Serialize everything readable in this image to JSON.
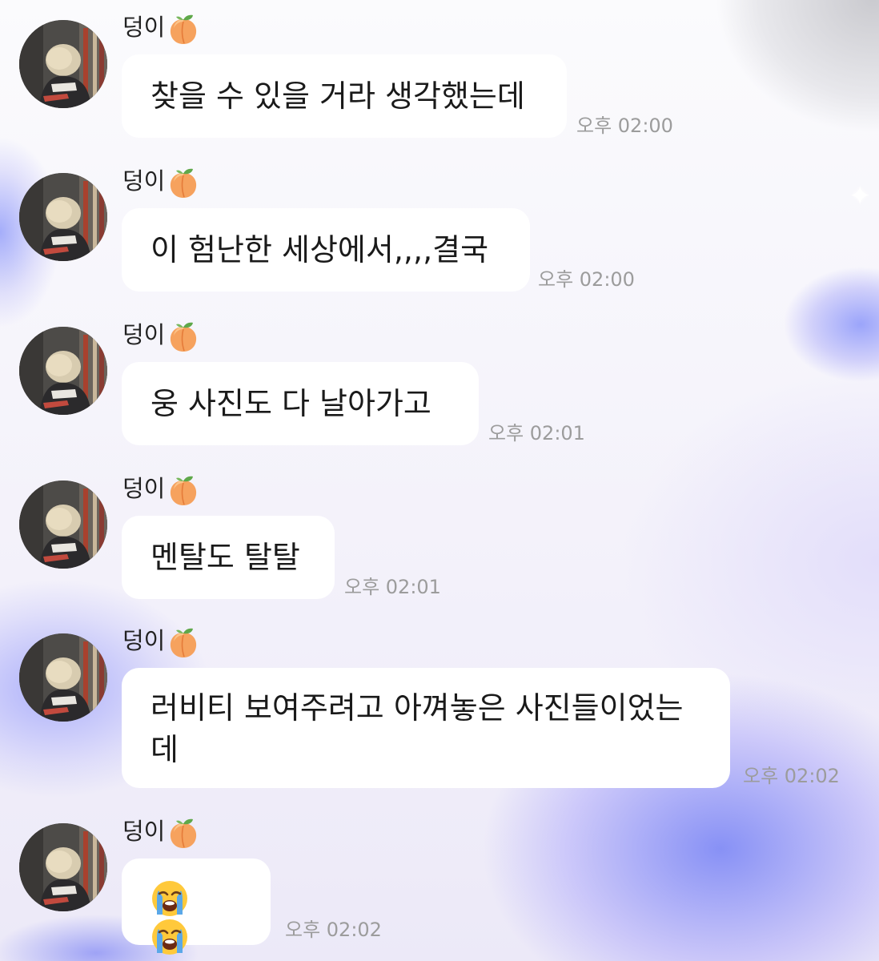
{
  "chat": {
    "messages": [
      {
        "sender": "덩이",
        "sender_emoji": "peach-icon",
        "text": "찾을 수 있을 거라 생각했는데",
        "time": "오후 02:00"
      },
      {
        "sender": "덩이",
        "sender_emoji": "peach-icon",
        "text": "이 험난한 세상에서,,,,결국",
        "time": "오후 02:00"
      },
      {
        "sender": "덩이",
        "sender_emoji": "peach-icon",
        "text": "웅 사진도 다 날아가고",
        "time": "오후 02:01"
      },
      {
        "sender": "덩이",
        "sender_emoji": "peach-icon",
        "text": "멘탈도 탈탈",
        "time": "오후 02:01"
      },
      {
        "sender": "덩이",
        "sender_emoji": "peach-icon",
        "text_line1": "러비티 보여주려고 아껴놓은 사진들이었는",
        "text_line2": "데",
        "time": "오후 02:02"
      },
      {
        "sender": "덩이",
        "sender_emoji": "peach-icon",
        "emojis": [
          "loudly-crying-face-icon",
          "loudly-crying-face-icon"
        ],
        "time": "오후 02:02"
      }
    ]
  },
  "colors": {
    "bubble": "#ffffff",
    "text": "#1a1a1a",
    "time": "#9c9c9c"
  }
}
